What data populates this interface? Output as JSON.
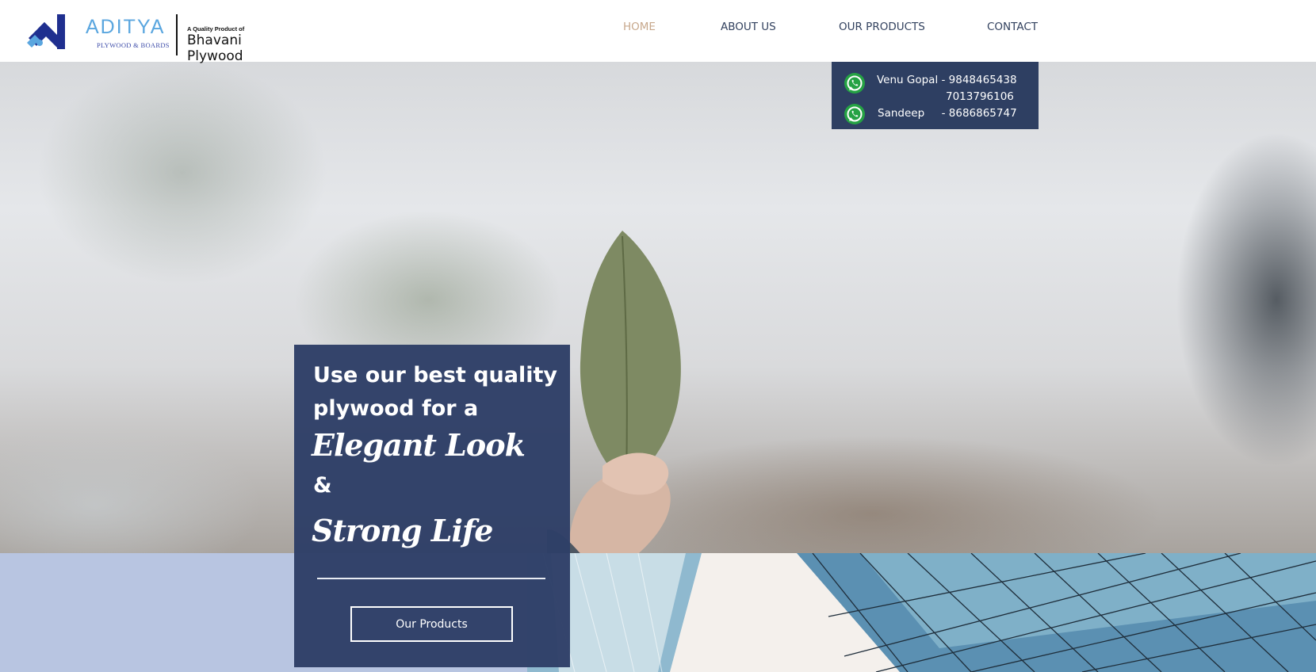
{
  "header": {
    "logo": {
      "brand": "ADITYA",
      "subtitle": "PLYWOOD & BOARDS",
      "tagline": "A Quality Product of",
      "company": "Bhavani Plywood",
      "mark_colors": {
        "primary": "#1f2f8f",
        "accent": "#5aa6df"
      }
    },
    "nav": {
      "items": [
        {
          "label": "HOME",
          "active": true
        },
        {
          "label": "ABOUT US",
          "active": false
        },
        {
          "label": "OUR PRODUCTS",
          "active": false
        },
        {
          "label": "CONTACT",
          "active": false
        }
      ],
      "active_color": "#c7a88c",
      "text_color": "#33425f"
    }
  },
  "contact_box": {
    "background": "#2e3f62",
    "icon": "whatsapp-icon",
    "lines": [
      {
        "text": "Venu Gopal - 9848465438"
      },
      {
        "text": "7013796106"
      },
      {
        "text": "Sandeep     - 8686865747"
      }
    ]
  },
  "hero": {
    "heading": "Use our best quality plywood for a",
    "highlight_1": "Elegant Look",
    "ampersand": "&",
    "highlight_2": "Strong Life",
    "button_label": "Our Products",
    "card_color": "#2e3f67"
  },
  "band": {
    "left_color": "#b8c5e1"
  }
}
